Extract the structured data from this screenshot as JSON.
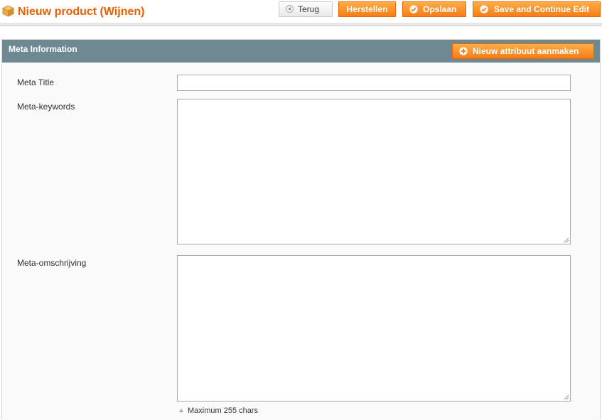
{
  "header": {
    "title": "Nieuw product (Wijnen)",
    "icon": "box-icon",
    "buttons": {
      "back": "Terug",
      "reset": "Herstellen",
      "save": "Opslaan",
      "save_continue": "Save and Continue Edit"
    }
  },
  "section": {
    "title": "Meta Information",
    "new_attribute_button": "Nieuw attribuut aanmaken"
  },
  "form": {
    "meta_title": {
      "label": "Meta Title",
      "value": ""
    },
    "meta_keywords": {
      "label": "Meta-keywords",
      "value": ""
    },
    "meta_description": {
      "label": "Meta-omschrijving",
      "value": "",
      "note": "Maximum 255 chars"
    }
  },
  "colors": {
    "accent": "#eb5e00",
    "button_orange": "#f77c16",
    "section_header": "#6f8992"
  }
}
